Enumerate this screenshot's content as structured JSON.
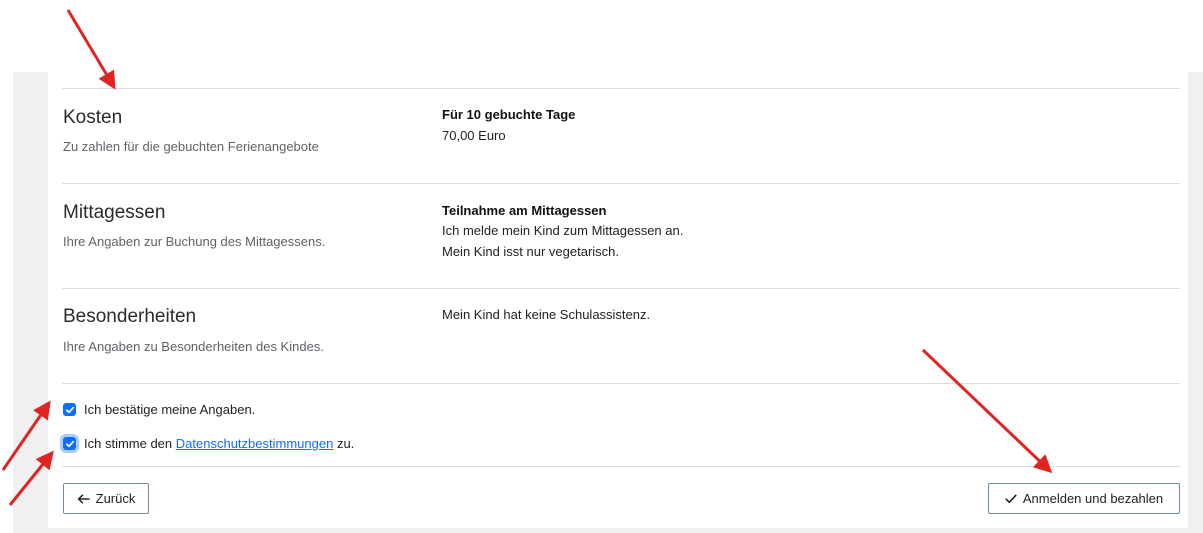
{
  "sections": [
    {
      "title": "Kosten",
      "description": "Zu zahlen für die gebuchten Ferienangebote",
      "value_heading": "Für 10 gebuchte Tage",
      "value_lines": [
        "70,00 Euro"
      ]
    },
    {
      "title": "Mittagessen",
      "description": "Ihre Angaben zur Buchung des Mittagessens.",
      "value_heading": "Teilnahme am Mittagessen",
      "value_lines": [
        "Ich melde mein Kind zum Mittagessen an.",
        "Mein Kind isst nur vegetarisch."
      ]
    },
    {
      "title": "Besonderheiten",
      "description": "Ihre Angaben zu Besonderheiten des Kindes.",
      "value_lines": [
        "Mein Kind hat keine Schulassistenz."
      ]
    }
  ],
  "confirm": {
    "checked": true,
    "label": "Ich bestätige meine Angaben."
  },
  "privacy": {
    "checked": true,
    "prefix": "Ich stimme den",
    "link": "Datenschutzbestimmungen",
    "suffix": "zu."
  },
  "buttons": {
    "back_label": "Zurück",
    "submit_label": "Anmelden und bezahlen"
  },
  "icons": {
    "back": "arrow-left-icon",
    "submit": "check-icon",
    "checkbox": "checkmark-icon"
  },
  "colors": {
    "accent": "#0d6efd",
    "annotation_arrow": "#e02424"
  }
}
